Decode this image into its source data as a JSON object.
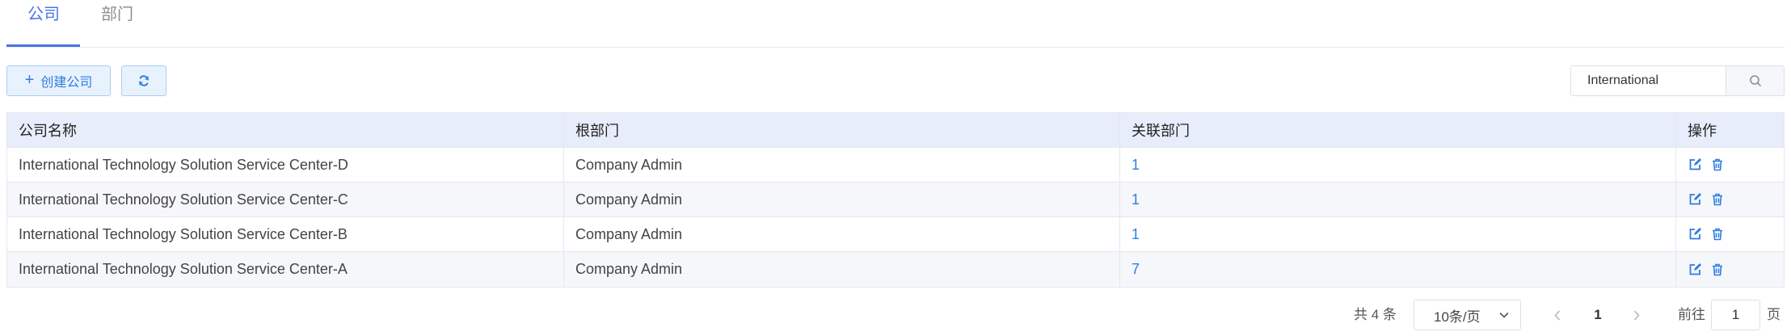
{
  "tabs": [
    {
      "label": "公司",
      "active": true
    },
    {
      "label": "部门",
      "active": false
    }
  ],
  "toolbar": {
    "create_label": "创建公司",
    "create_icon": "plus-icon",
    "refresh_icon": "refresh-icon"
  },
  "search": {
    "value": "International",
    "icon": "search-icon"
  },
  "table": {
    "headers": [
      "公司名称",
      "根部门",
      "关联部门",
      "操作"
    ],
    "rows": [
      {
        "name": "International Technology Solution Service Center-D",
        "root_dept": "Company Admin",
        "linked": "1"
      },
      {
        "name": "International Technology Solution Service Center-C",
        "root_dept": "Company Admin",
        "linked": "1"
      },
      {
        "name": "International Technology Solution Service Center-B",
        "root_dept": "Company Admin",
        "linked": "1"
      },
      {
        "name": "International Technology Solution Service Center-A",
        "root_dept": "Company Admin",
        "linked": "7"
      }
    ],
    "row_actions": [
      "edit-icon",
      "delete-icon"
    ]
  },
  "pagination": {
    "total": "共 4 条",
    "page_size": "10条/页",
    "current_page": "1",
    "goto_label": "前往",
    "goto_value": "1",
    "page_suffix": "页"
  },
  "colors": {
    "accent": "#4a74e8",
    "link": "#2f7ce0",
    "header_bg": "#e8edfb"
  }
}
